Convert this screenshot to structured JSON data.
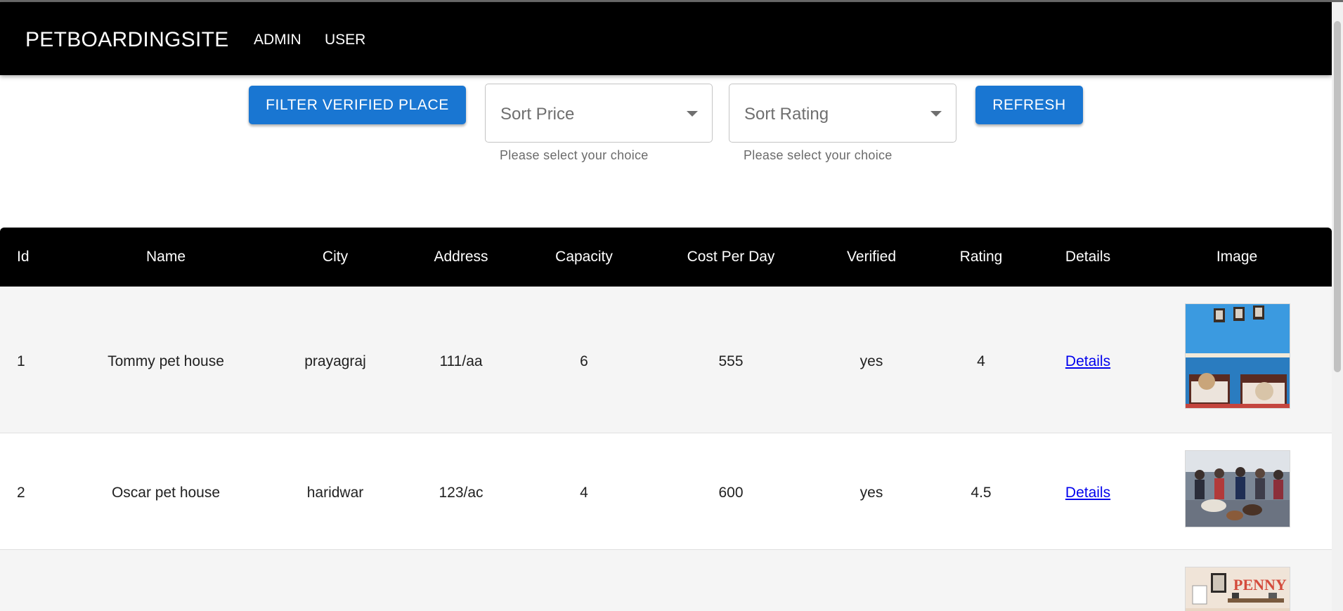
{
  "appbar": {
    "brand": "PETBOARDINGSITE",
    "nav": [
      "ADMIN",
      "USER"
    ]
  },
  "toolbar": {
    "filter_label": "FILTER VERIFIED PLACE",
    "refresh_label": "REFRESH",
    "sort_price": {
      "placeholder": "Sort Price",
      "helper": "Please select your choice"
    },
    "sort_rating": {
      "placeholder": "Sort Rating",
      "helper": "Please select your choice"
    }
  },
  "table": {
    "columns": [
      "Id",
      "Name",
      "City",
      "Address",
      "Capacity",
      "Cost Per Day",
      "Verified",
      "Rating",
      "Details",
      "Image"
    ],
    "rows": [
      {
        "id": "1",
        "name": "Tommy pet house",
        "city": "prayagraj",
        "address": "111/aa",
        "capacity": "6",
        "cost": "555",
        "verified": "yes",
        "rating": "4",
        "details": "Details"
      },
      {
        "id": "2",
        "name": "Oscar pet house",
        "city": "haridwar",
        "address": "123/ac",
        "capacity": "4",
        "cost": "600",
        "verified": "yes",
        "rating": "4.5",
        "details": "Details"
      },
      {
        "thumb_text": "PENNY"
      }
    ]
  },
  "colors": {
    "appbar": "#000000",
    "primary_button": "#1976d2",
    "link": "#0000ee",
    "row_alt": "#f5f5f5"
  }
}
